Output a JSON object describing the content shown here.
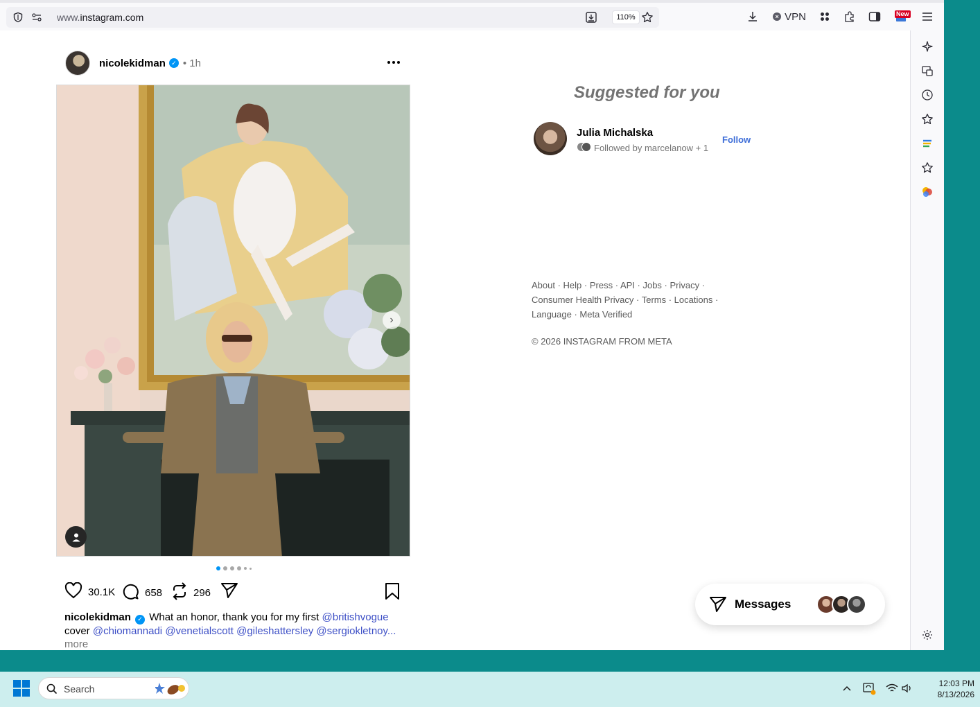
{
  "browser": {
    "url_host_prefix": "www.",
    "url_host": "instagram.com",
    "zoom": "110%",
    "vpn_label": "VPN",
    "new_badge": "New"
  },
  "post": {
    "username": "nicolekidman",
    "time": "1h",
    "time_sep": "•",
    "likes": "30.1K",
    "comments": "658",
    "reposts": "296",
    "carousel_count": 6,
    "carousel_active": 0,
    "caption": {
      "username": "nicolekidman",
      "text": "What an honor, thank you for my first",
      "line2_prefix": "cover",
      "mentions": [
        "@britishvogue",
        "@chiomannadi",
        "@venetialscott",
        "@gileshattersley",
        "@sergiokletnoy..."
      ],
      "more": "more"
    }
  },
  "suggested": {
    "title": "Suggested for you",
    "items": [
      {
        "name": "Julia Michalska",
        "subtitle": "Followed by marcelanow + 1",
        "action": "Follow"
      }
    ]
  },
  "footer": {
    "links": [
      "About",
      "Help",
      "Press",
      "API",
      "Jobs",
      "Privacy",
      "Consumer Health Privacy",
      "Terms",
      "Locations",
      "Language",
      "Meta Verified"
    ],
    "copyright": "© 2026 INSTAGRAM FROM META"
  },
  "messages": {
    "label": "Messages"
  },
  "taskbar": {
    "search_placeholder": "Search",
    "time": "12:03 PM",
    "date": "8/13/2026"
  },
  "colors": {
    "accent_blue": "#0095f6",
    "mention_blue": "#3d4fc6",
    "desktop": "#0b8b8b"
  }
}
